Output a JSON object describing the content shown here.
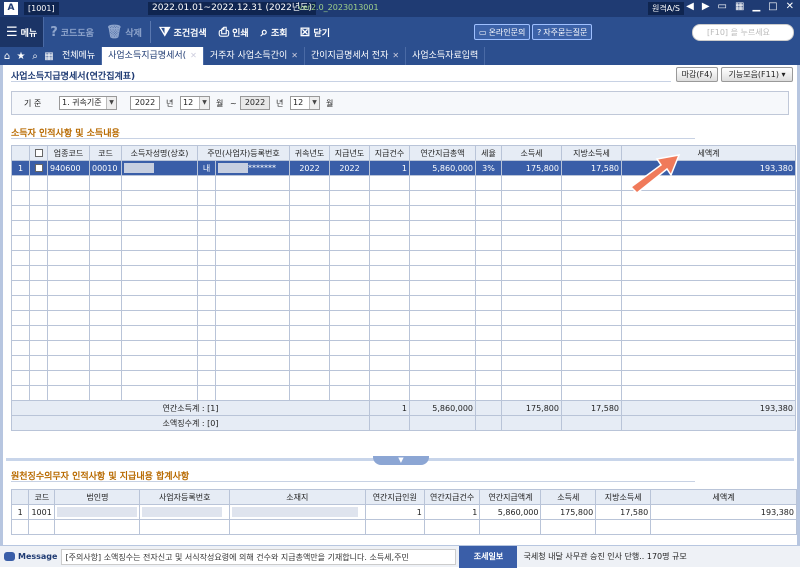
{
  "titlebar": {
    "logo": "A",
    "id": "[1001]",
    "period": "2022.01.01~2022.12.31  (2022년도)",
    "version": "ver2.0_2023013001",
    "remote": "원격A/S"
  },
  "toolbar": {
    "menu": "메뉴",
    "code_help": "코드도움",
    "delete": "삭제",
    "cond_search": "조건검색",
    "print": "인쇄",
    "query": "조회",
    "close": "닫기",
    "online_inquiry": "온라인문의",
    "faq": "자주묻는질문",
    "search_placeholder": "[F10] 을 누르세요"
  },
  "tabs": [
    {
      "label": "전체메뉴"
    },
    {
      "label": "사업소득지급명세서(",
      "active": true
    },
    {
      "label": "거주자 사업소득간이"
    },
    {
      "label": "간이지급명세서 전자"
    },
    {
      "label": "사업소득자료입력"
    }
  ],
  "page": {
    "title": "사업소득지급명세서(연간집계표)",
    "close_btn": "마감(F4)",
    "func_btn": "기능모음(F11)"
  },
  "filter": {
    "label": "기  준",
    "basis": "1. 귀속기준",
    "from_year": "2022",
    "year_unit": "년",
    "from_month": "12",
    "month_unit": "월",
    "tilde": "~",
    "to_year": "2022",
    "to_month": "12"
  },
  "section1": {
    "title": "소득자 인적사항 및 소득내용"
  },
  "grid1": {
    "headers": [
      "",
      "",
      "업종코드",
      "코드",
      "소득자성명(상호)",
      "주민(사업자)등록번호",
      "",
      "귀속년도",
      "지급년도",
      "지급건수",
      "연간지급총액",
      "세율",
      "소득세",
      "지방소득세",
      "세액계"
    ],
    "row": {
      "num": "1",
      "industry": "940600",
      "code": "00010",
      "nat": "내",
      "reg_suffix": "*******",
      "attr_year": "2022",
      "pay_year": "2022",
      "count": "1",
      "total": "5,860,000",
      "rate": "3%",
      "income_tax": "175,800",
      "local_tax": "17,580",
      "tax_sum": "193,380"
    },
    "sum_label": "연간소득계 : [1]",
    "sum_count": "1",
    "sum_total": "5,860,000",
    "sum_income_tax": "175,800",
    "sum_local_tax": "17,580",
    "sum_tax_sum": "193,380",
    "loss_label": "소액징수계 : [0]"
  },
  "section2": {
    "title": "원천징수의무자 인적사항 및 지급내용 합계사항"
  },
  "grid2": {
    "headers": [
      "",
      "코드",
      "법인명",
      "사업자등록번호",
      "소재지",
      "연간지급인원",
      "연간지급건수",
      "연간지급액계",
      "소득세",
      "지방소득세",
      "세액계"
    ],
    "row": {
      "num": "1",
      "code": "1001",
      "people": "1",
      "count": "1",
      "total": "5,860,000",
      "income_tax": "175,800",
      "local_tax": "17,580",
      "tax_sum": "193,380"
    }
  },
  "status": {
    "message_label": "Message",
    "message": "[주의사항] 소액징수는 전자신고 및 서식작성요령에 의해 건수와 지급총액만을 기재합니다. 소득세,주민",
    "news_label": "조세일보",
    "news": "국세청 내달 사무관 승진 인사 단행.. 170명 규모"
  }
}
